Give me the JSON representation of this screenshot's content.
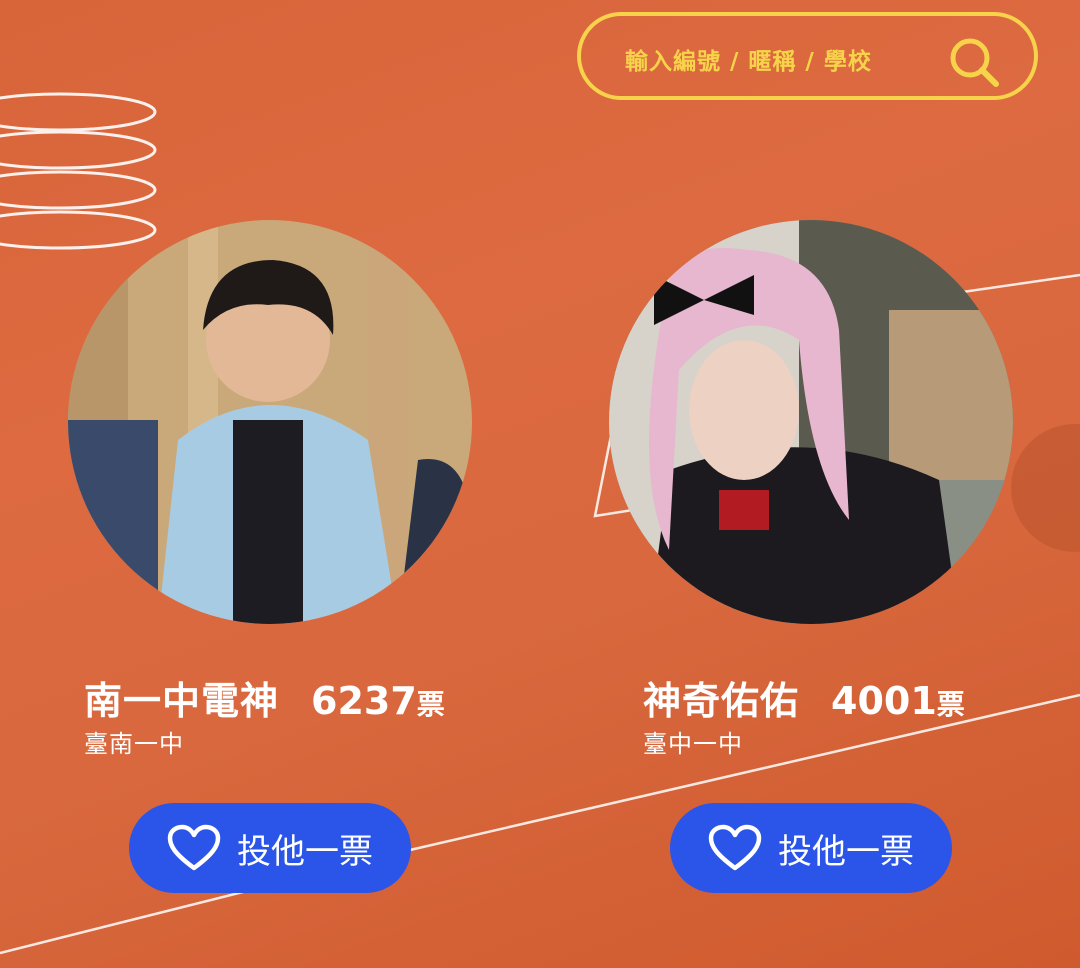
{
  "search": {
    "placeholder": "輸入編號 / 暱稱 / 學校",
    "icon": "search-icon"
  },
  "colors": {
    "background": "#d8643a",
    "search_accent": "#f6d34a",
    "button": "#2a55e8"
  },
  "candidates": [
    {
      "name": "南一中電神",
      "votes": "6237",
      "votes_unit": "票",
      "school": "臺南一中",
      "vote_label": "投他一票",
      "vote_icon": "heart-icon"
    },
    {
      "name": "神奇佑佑",
      "votes": "4001",
      "votes_unit": "票",
      "school": "臺中一中",
      "vote_label": "投他一票",
      "vote_icon": "heart-icon"
    }
  ]
}
